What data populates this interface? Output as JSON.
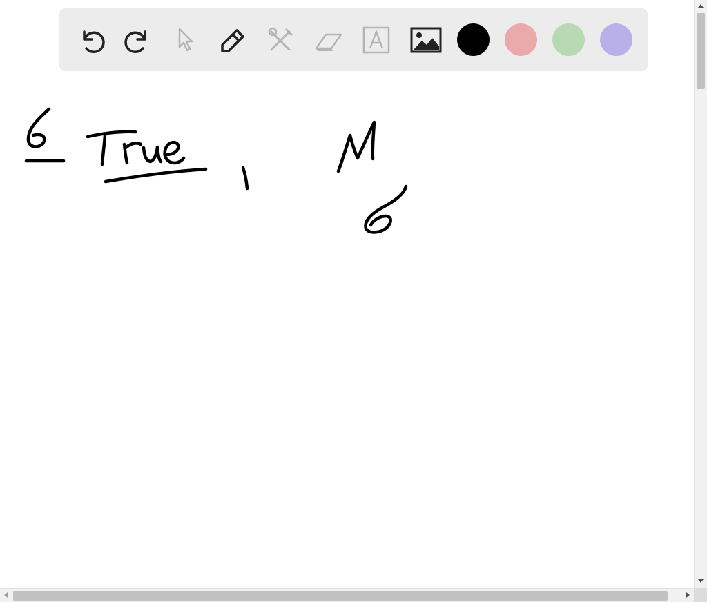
{
  "toolbar": {
    "tools": [
      {
        "name": "undo-icon",
        "enabled": true
      },
      {
        "name": "redo-icon",
        "enabled": true
      },
      {
        "name": "select-pointer-icon",
        "enabled": false
      },
      {
        "name": "pen-icon",
        "enabled": true
      },
      {
        "name": "tools-icon",
        "enabled": false
      },
      {
        "name": "eraser-icon",
        "enabled": false
      },
      {
        "name": "text-icon",
        "enabled": false
      },
      {
        "name": "image-icon",
        "enabled": true
      }
    ],
    "colors": [
      "#000000",
      "#eaa9aa",
      "#b9d9b5",
      "#b9b0ea"
    ]
  },
  "canvas": {
    "strokes": [
      "6",
      "True",
      "1",
      "M",
      "6"
    ]
  }
}
